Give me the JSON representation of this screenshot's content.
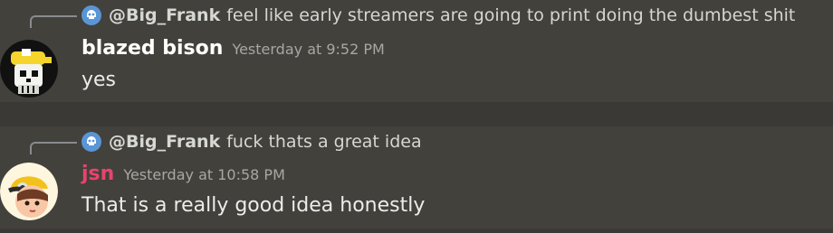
{
  "messages": [
    {
      "reply": {
        "author": "@Big_Frank",
        "text": "feel like early streamers are going to print doing the dumbest shit",
        "icon": "skull-icon"
      },
      "author": {
        "name": "blazed bison",
        "color": "#ffffff",
        "avatar_icon": "skull-avatar"
      },
      "timestamp": "Yesterday at 9:52 PM",
      "text": "yes"
    },
    {
      "reply": {
        "author": "@Big_Frank",
        "text": "fuck thats a great idea",
        "icon": "skull-icon"
      },
      "author": {
        "name": "jsn",
        "color": "#e8436e",
        "avatar_icon": "cartoon-avatar"
      },
      "timestamp": "Yesterday at 10:58 PM",
      "text": "That is a really good idea honestly"
    }
  ],
  "colors": {
    "background": "#3a3936",
    "message_background": "#42413c",
    "reply_avatar": "#5a95d6",
    "timestamp": "#a7a7a4"
  }
}
